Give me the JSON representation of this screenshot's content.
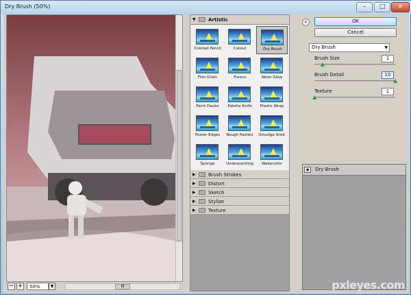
{
  "window": {
    "title": "Dry Brush (50%)",
    "min_label": "–",
    "max_label": "□",
    "close_label": "✕"
  },
  "preview": {
    "zoom": "50%",
    "zoom_out_label": "−",
    "zoom_in_label": "+",
    "drop_label": "▼",
    "scroll_label": "III"
  },
  "gallery": {
    "open_category": "Artistic",
    "filters": [
      {
        "label": "Colored Pencil"
      },
      {
        "label": "Cutout"
      },
      {
        "label": "Dry Brush",
        "selected": true
      },
      {
        "label": "Film Grain"
      },
      {
        "label": "Fresco"
      },
      {
        "label": "Neon Glow"
      },
      {
        "label": "Paint Daubs"
      },
      {
        "label": "Palette Knife"
      },
      {
        "label": "Plastic Wrap"
      },
      {
        "label": "Poster Edges"
      },
      {
        "label": "Rough Pastels"
      },
      {
        "label": "Smudge Stick"
      },
      {
        "label": "Sponge"
      },
      {
        "label": "Underpainting"
      },
      {
        "label": "Watercolor"
      }
    ],
    "categories": [
      "Brush Strokes",
      "Distort",
      "Sketch",
      "Stylize",
      "Texture"
    ]
  },
  "controls": {
    "ok_label": "OK",
    "cancel_label": "Cancel",
    "selected_filter": "Dry Brush",
    "params": [
      {
        "label": "Brush Size",
        "value": "1",
        "level": 0.1
      },
      {
        "label": "Brush Detail",
        "value": "10",
        "level": 1.0
      },
      {
        "label": "Texture",
        "value": "1",
        "level": 0.0
      }
    ]
  },
  "layers": {
    "items": [
      "Dry Brush"
    ]
  },
  "watermark": "pxleyes.com",
  "colors": {
    "accent": "#3b7ad0",
    "ok_bg": "#bedcf8",
    "panel": "#d4d0c8",
    "slider_knob": "#3a8f3a"
  }
}
